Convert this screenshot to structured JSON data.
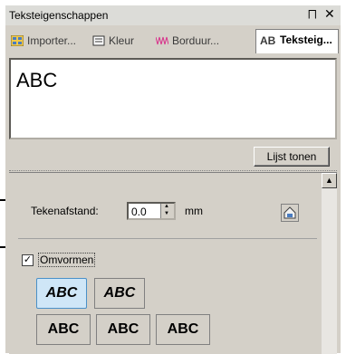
{
  "window": {
    "title": "Teksteigenschappen",
    "pin_glyph": "  →",
    "close_glyph": "×"
  },
  "tabs": [
    {
      "label": "Importer...",
      "icon": "import-icon"
    },
    {
      "label": "Kleur",
      "icon": "color-icon"
    },
    {
      "label": "Borduur...",
      "icon": "embroidery-icon"
    },
    {
      "label": "Teksteig...",
      "icon": "ab-text-icon",
      "icon_text": "AB",
      "active": true
    }
  ],
  "text_input": {
    "value": "ABC"
  },
  "list_button": {
    "label": "Lijst tonen"
  },
  "spacing": {
    "label": "Tekenafstand:",
    "value": "0.0",
    "unit": "mm"
  },
  "transform": {
    "label": "Omvormen",
    "checked": true
  },
  "shapes": [
    "ABC",
    "ABC",
    "ABC",
    "ABC",
    "ABC"
  ],
  "colors": {
    "panel": "#d4d0c8",
    "active_shape": "#cfe6f7",
    "accent": "#4a90c8"
  }
}
